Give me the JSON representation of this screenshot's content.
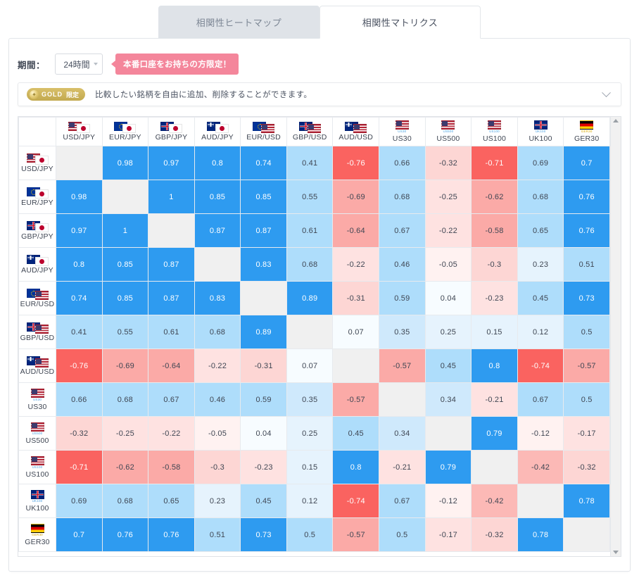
{
  "tabs": [
    {
      "label": "相関性ヒートマップ",
      "active": false
    },
    {
      "label": "相関性マトリクス",
      "active": true
    }
  ],
  "period": {
    "label": "期間：",
    "value": "24時間",
    "options": [
      "24時間"
    ],
    "tooltip": "本番口座をお持ちの方限定！",
    "tooltip_color": "#f4869b"
  },
  "notice": {
    "badge_brand": "GOLD",
    "badge_suffix": "限定",
    "badge_color": "#c2a94f",
    "text": "比較したい銘柄を自由に追加、削除することができます。"
  },
  "chart_data": {
    "type": "heatmap",
    "title": "相関性マトリクス",
    "categories": [
      "USD/JPY",
      "EUR/JPY",
      "GBP/JPY",
      "AUD/JPY",
      "EUR/USD",
      "GBP/USD",
      "AUD/USD",
      "US30",
      "US500",
      "US100",
      "UK100",
      "GER30"
    ],
    "symbols": [
      {
        "label": "USD/JPY",
        "kind": "pair",
        "flags": [
          "usd",
          "jpy"
        ]
      },
      {
        "label": "EUR/JPY",
        "kind": "pair",
        "flags": [
          "eur",
          "jpy"
        ]
      },
      {
        "label": "GBP/JPY",
        "kind": "pair",
        "flags": [
          "gbp",
          "jpy"
        ]
      },
      {
        "label": "AUD/JPY",
        "kind": "pair",
        "flags": [
          "aud",
          "jpy"
        ]
      },
      {
        "label": "EUR/USD",
        "kind": "pair",
        "flags": [
          "eur",
          "usd"
        ]
      },
      {
        "label": "GBP/USD",
        "kind": "pair",
        "flags": [
          "gbp",
          "usd"
        ]
      },
      {
        "label": "AUD/USD",
        "kind": "pair",
        "flags": [
          "aud",
          "usd"
        ]
      },
      {
        "label": "US30",
        "kind": "index",
        "flags": [
          "usd"
        ],
        "mini": "US30",
        "mini_color": "#4a9fe0"
      },
      {
        "label": "US500",
        "kind": "index",
        "flags": [
          "usd"
        ],
        "mini": "US500",
        "mini_color": "#4a9fe0"
      },
      {
        "label": "US100",
        "kind": "index",
        "flags": [
          "usd"
        ],
        "mini": "US100",
        "mini_color": "#4a9fe0"
      },
      {
        "label": "UK100",
        "kind": "index",
        "flags": [
          "gbp"
        ],
        "mini": "UK100",
        "mini_color": "#4a9fe0"
      },
      {
        "label": "GER30",
        "kind": "index",
        "flags": [
          "ger"
        ],
        "mini": "GER30",
        "mini_color": "#d8a800"
      }
    ],
    "values": [
      [
        null,
        0.98,
        0.97,
        0.8,
        0.74,
        0.41,
        -0.76,
        0.66,
        -0.32,
        -0.71,
        0.69,
        0.7
      ],
      [
        0.98,
        null,
        1,
        0.85,
        0.85,
        0.55,
        -0.69,
        0.68,
        -0.25,
        -0.62,
        0.68,
        0.76
      ],
      [
        0.97,
        1,
        null,
        0.87,
        0.87,
        0.61,
        -0.64,
        0.67,
        -0.22,
        -0.58,
        0.65,
        0.76
      ],
      [
        0.8,
        0.85,
        0.87,
        null,
        0.83,
        0.68,
        -0.22,
        0.46,
        -0.05,
        -0.3,
        0.23,
        0.51
      ],
      [
        0.74,
        0.85,
        0.87,
        0.83,
        null,
        0.89,
        -0.31,
        0.59,
        0.04,
        -0.23,
        0.45,
        0.73
      ],
      [
        0.41,
        0.55,
        0.61,
        0.68,
        0.89,
        null,
        0.07,
        0.35,
        0.25,
        0.15,
        0.12,
        0.5
      ],
      [
        -0.76,
        -0.69,
        -0.64,
        -0.22,
        -0.31,
        0.07,
        null,
        -0.57,
        0.45,
        0.8,
        -0.74,
        -0.57
      ],
      [
        0.66,
        0.68,
        0.67,
        0.46,
        0.59,
        0.35,
        -0.57,
        null,
        0.34,
        -0.21,
        0.67,
        0.5
      ],
      [
        -0.32,
        -0.25,
        -0.22,
        -0.05,
        0.04,
        0.25,
        0.45,
        0.34,
        null,
        0.79,
        -0.12,
        -0.17
      ],
      [
        -0.71,
        -0.62,
        -0.58,
        -0.3,
        -0.23,
        0.15,
        0.8,
        -0.21,
        0.79,
        null,
        -0.42,
        -0.32
      ],
      [
        0.69,
        0.68,
        0.65,
        0.23,
        0.45,
        0.12,
        -0.74,
        0.67,
        -0.12,
        -0.42,
        null,
        0.78
      ],
      [
        0.7,
        0.76,
        0.76,
        0.51,
        0.73,
        0.5,
        -0.57,
        0.5,
        -0.17,
        -0.32,
        0.78,
        null
      ]
    ],
    "value_range": [
      -1,
      1
    ],
    "colors": {
      "positive_strong": "#2e9bf0",
      "positive_mid": "#aeddfb",
      "neutral": "#ffffff",
      "negative_mid": "#fab6b3",
      "negative_strong": "#fa6360",
      "diagonal": "#f0f0f0"
    },
    "legend": "",
    "grid": true
  },
  "scrollbar": {
    "up": "▲",
    "down": "▼"
  }
}
